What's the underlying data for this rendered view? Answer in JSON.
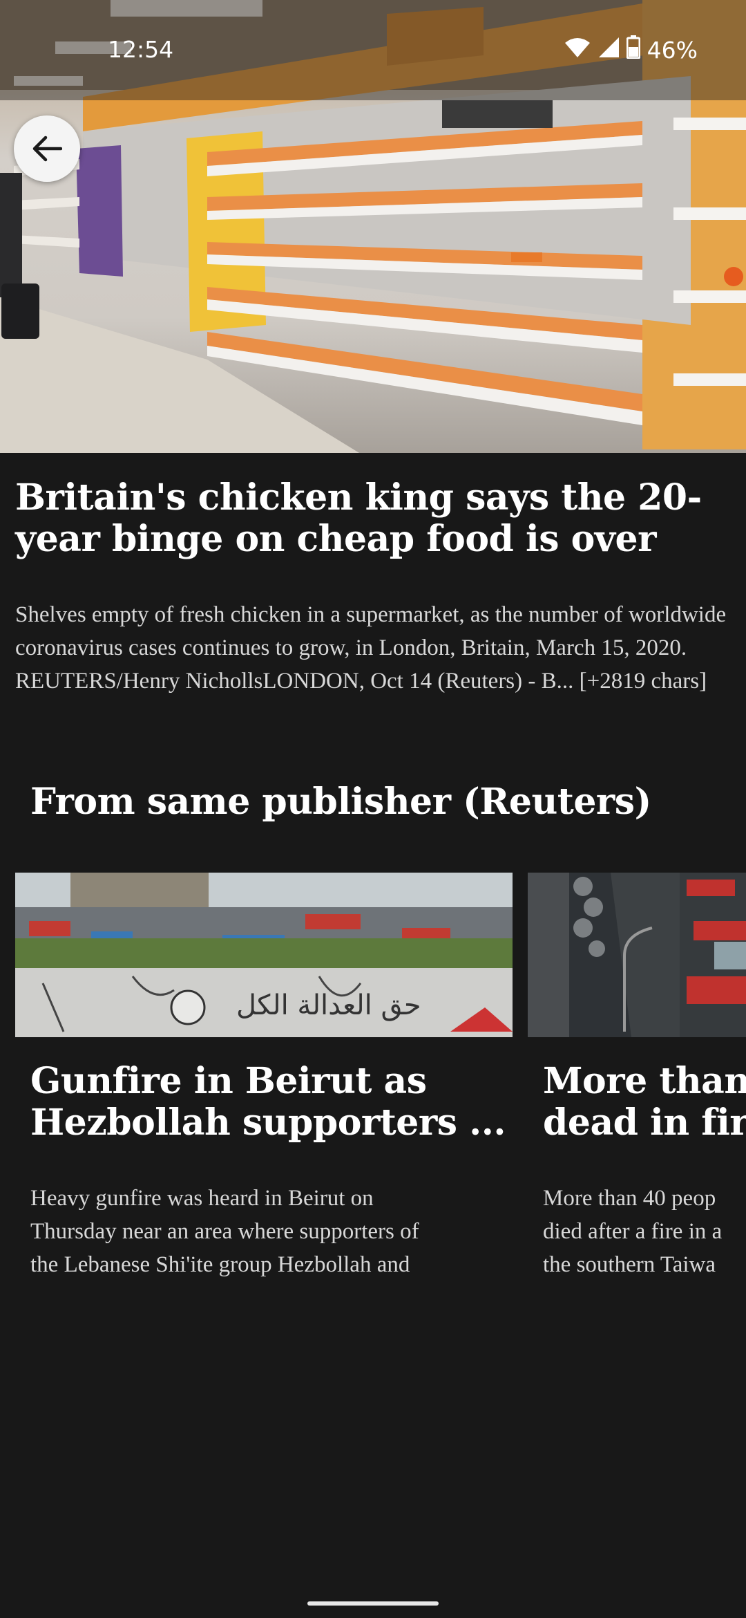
{
  "status_bar": {
    "time": "12:54",
    "battery": "46%"
  },
  "hero": {
    "image_alt": "Empty supermarket chicken shelves"
  },
  "article": {
    "title": "Britain's chicken king says the 20-year binge on cheap food is over",
    "description": "Shelves empty of fresh chicken in a supermarket, as the number of worldwide coronavirus cases continues to grow, in London, Britain, March 15, 2020. REUTERS/Henry NichollsLONDON, Oct 14 (Reuters) - B... [+2819 chars]"
  },
  "section": {
    "heading": "From same publisher (Reuters)"
  },
  "cards": [
    {
      "title": "Gunfire in Beirut as\nHezbollah supporters ...",
      "description": "Heavy gunfire was heard in Beirut on\nThursday near an area where supporters of\nthe Lebanese Shi'ite group Hezbollah and",
      "image_caption": "حق العدالة الكل"
    },
    {
      "title": "More than\ndead in fir",
      "description": "More than 40 peop\ndied after a fire in a\nthe southern Taiwa"
    }
  ],
  "colors": {
    "background": "#181818",
    "text_primary": "#ffffff",
    "text_secondary": "#d8d8d8"
  }
}
